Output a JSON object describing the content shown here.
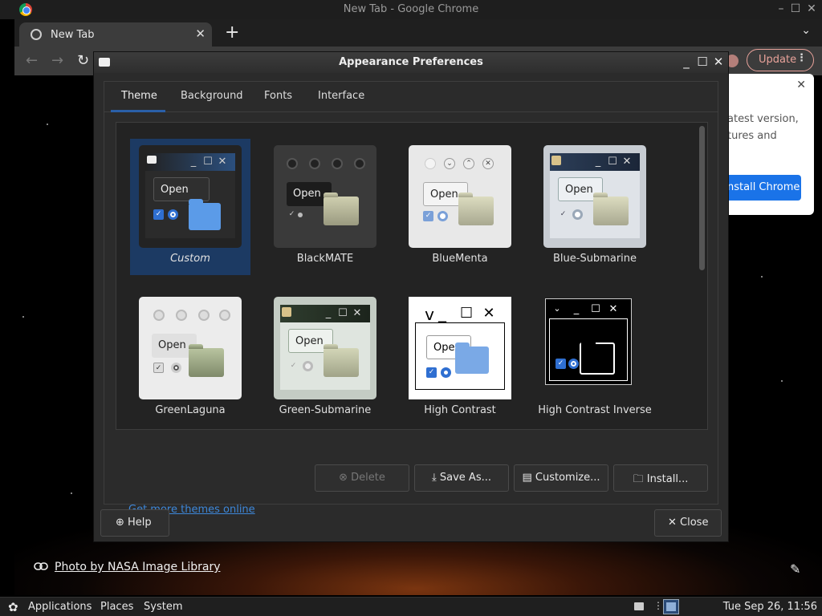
{
  "chrome": {
    "window_title": "New Tab - Google Chrome",
    "tab_label": "New Tab",
    "update_label": "Update",
    "popup_line1": "atest version,",
    "popup_line2": "tures and",
    "popup_install_label": "nstall Chrome",
    "photo_credit": "Photo by NASA Image Library"
  },
  "dialog": {
    "title": "Appearance Preferences",
    "tabs": [
      "Theme",
      "Background",
      "Fonts",
      "Interface"
    ],
    "themes": [
      {
        "name": "Custom",
        "selected": true
      },
      {
        "name": "BlackMATE"
      },
      {
        "name": "BlueMenta"
      },
      {
        "name": "Blue-Submarine"
      },
      {
        "name": "GreenLaguna"
      },
      {
        "name": "Green-Submarine"
      },
      {
        "name": "High Contrast"
      },
      {
        "name": "High Contrast Inverse"
      }
    ],
    "thumb_open_label": "Open",
    "buttons": {
      "delete": "Delete",
      "save_as": "Save As...",
      "customize": "Customize...",
      "install": "Install..."
    },
    "get_more_link": "Get more themes online",
    "help": "Help",
    "close": "Close"
  },
  "panel": {
    "applications": "Applications",
    "places": "Places",
    "system": "System",
    "clock": "Tue Sep 26, 11:56"
  },
  "colors": {
    "selection": "#1c3a63",
    "link": "#3d87d9",
    "install_chrome": "#1a73e8"
  }
}
